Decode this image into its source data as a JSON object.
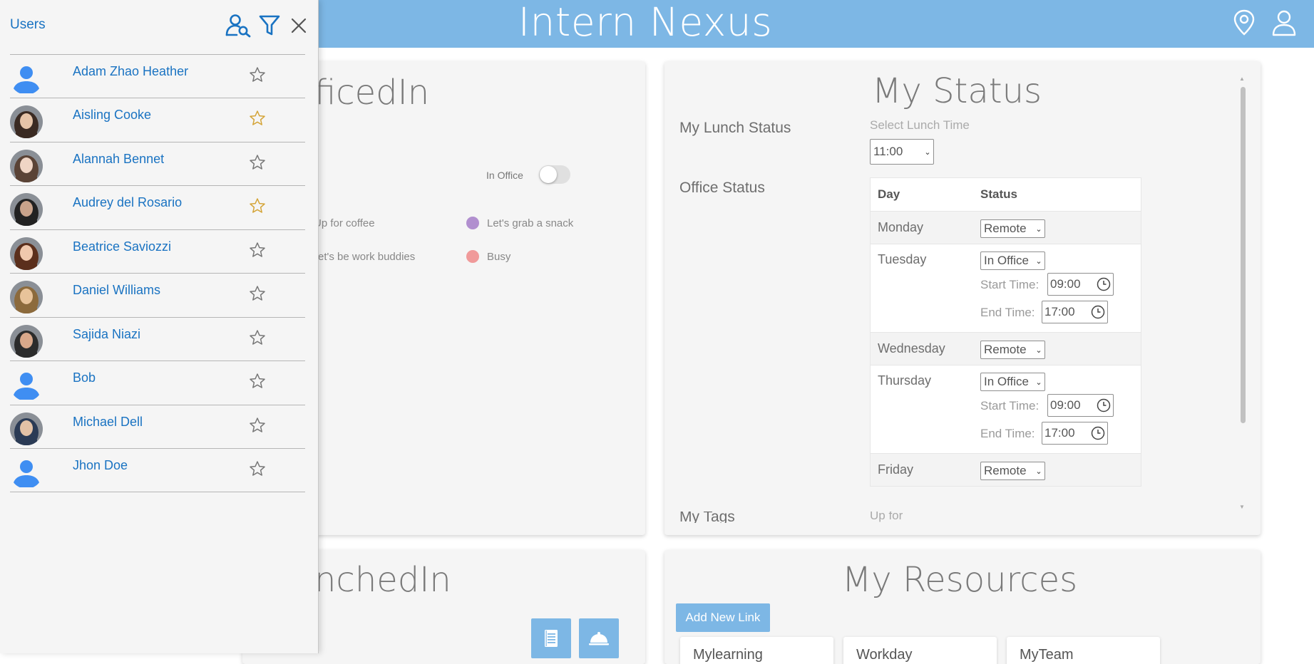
{
  "header": {
    "title": "Intern Nexus",
    "icons": [
      "location-pin-icon",
      "user-icon"
    ]
  },
  "officedin": {
    "title_visible": "ficedIn",
    "toggle_label": "In Office",
    "toggle_on": false,
    "legend": [
      {
        "label": "Up for coffee",
        "visible_text": "Up for coffee",
        "color": null
      },
      {
        "label": "Let's grab a snack",
        "visible_text": "Let's grab a snack",
        "color": "#b18fcf"
      },
      {
        "label": "Let's be work buddies",
        "visible_text": "et's be work buddies",
        "color": null
      },
      {
        "label": "Busy",
        "visible_text": "Busy",
        "color": "#f09a9a"
      }
    ]
  },
  "lunchedin": {
    "title_visible": "nchedIn",
    "buttons": [
      "notebook-icon",
      "food-cloche-icon"
    ]
  },
  "my_status": {
    "title": "My Status",
    "lunch_label": "My Lunch Status",
    "lunch_hint": "Select Lunch Time",
    "lunch_value": "11:00",
    "office_label": "Office Status",
    "table_headers": [
      "Day",
      "Status"
    ],
    "start_label": "Start Time:",
    "end_label": "End Time:",
    "days": [
      {
        "day": "Monday",
        "status": "Remote"
      },
      {
        "day": "Tuesday",
        "status": "In Office",
        "start": "09:00",
        "end": "17:00"
      },
      {
        "day": "Wednesday",
        "status": "Remote"
      },
      {
        "day": "Thursday",
        "status": "In Office",
        "start": "09:00",
        "end": "17:00"
      },
      {
        "day": "Friday",
        "status": "Remote"
      }
    ],
    "tags_label_partial": "My Tags",
    "tags_hint_partial": "Up for"
  },
  "my_resources": {
    "title": "My Resources",
    "add_button": "Add New Link",
    "cards_partial": [
      "Mylearning",
      "Workday",
      "MyTeam"
    ]
  },
  "users_panel": {
    "title": "Users",
    "icons": [
      "user-search-icon",
      "filter-icon",
      "close-icon"
    ],
    "users": [
      {
        "name": "Adam Zhao Heather",
        "favorite": false,
        "avatar": "default"
      },
      {
        "name": "Aisling Cooke",
        "favorite": true,
        "avatar": "photo"
      },
      {
        "name": "Alannah Bennet",
        "favorite": false,
        "avatar": "photo"
      },
      {
        "name": "Audrey del Rosario",
        "favorite": true,
        "avatar": "photo"
      },
      {
        "name": "Beatrice Saviozzi",
        "favorite": false,
        "avatar": "photo"
      },
      {
        "name": "Daniel Williams",
        "favorite": false,
        "avatar": "photo"
      },
      {
        "name": "Sajida Niazi",
        "favorite": false,
        "avatar": "photo"
      },
      {
        "name": "Bob",
        "favorite": false,
        "avatar": "default"
      },
      {
        "name": "Michael Dell",
        "favorite": false,
        "avatar": "photo"
      },
      {
        "name": "Jhon Doe",
        "favorite": false,
        "avatar": "default"
      }
    ]
  },
  "colors": {
    "accent": "#7db7e5",
    "link_blue": "#1a73c2",
    "favorite_star": "#d4a437"
  }
}
